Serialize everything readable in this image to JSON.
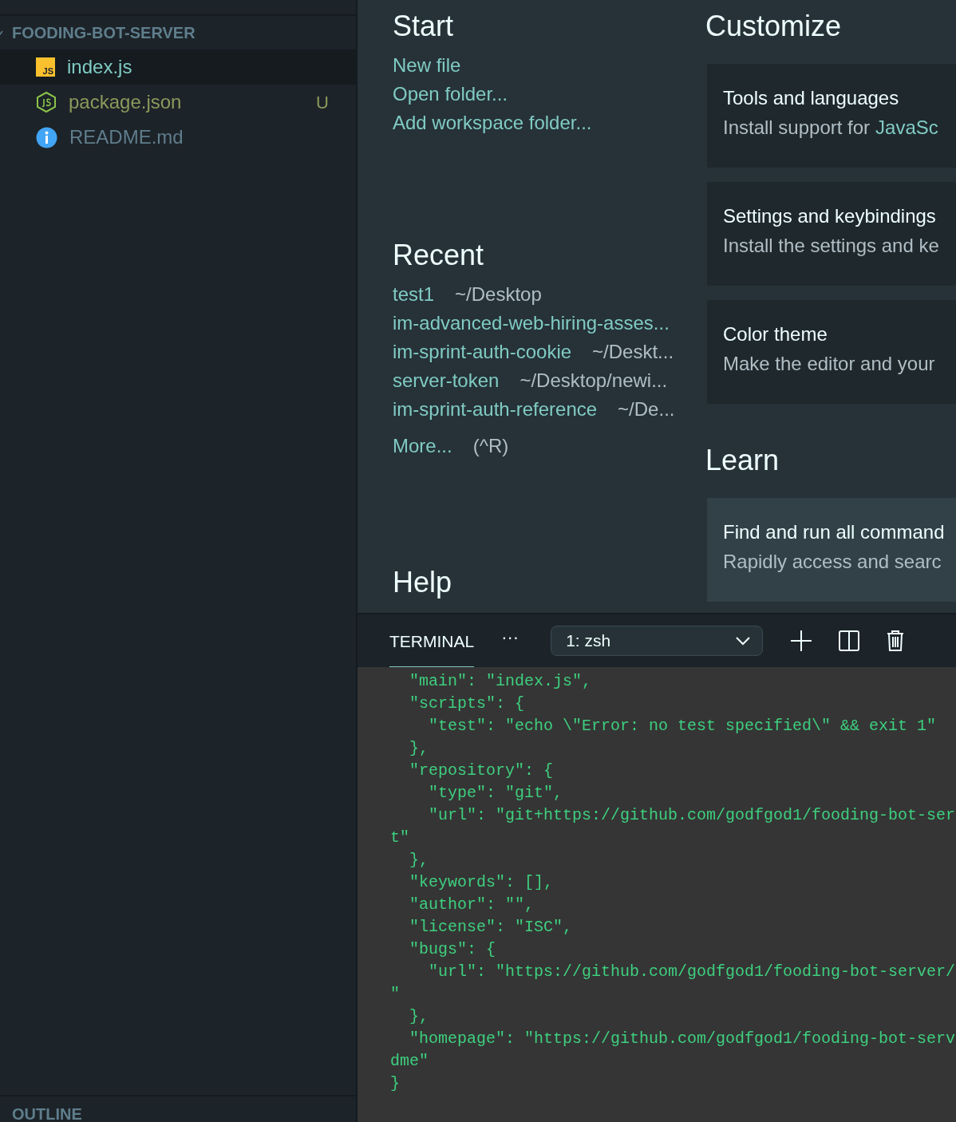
{
  "sidebar": {
    "folder": {
      "name": "FOODING-BOT-SERVER",
      "expanded": true
    },
    "files": [
      {
        "name": "index.js",
        "kind": "js",
        "icon_text": "JS",
        "selected": true
      },
      {
        "name": "package.json",
        "kind": "node",
        "selected": false,
        "git_status": "U"
      },
      {
        "name": "README.md",
        "kind": "info",
        "selected": false
      }
    ],
    "outline_title": "OUTLINE"
  },
  "welcome": {
    "start": {
      "title": "Start",
      "links": [
        "New file",
        "Open folder...",
        "Add workspace folder..."
      ]
    },
    "recent": {
      "title": "Recent",
      "items": [
        {
          "name": "test1",
          "path": "~/Desktop"
        },
        {
          "name": "im-advanced-web-hiring-asses..."
        },
        {
          "name": "im-sprint-auth-cookie",
          "path": "~/Deskt..."
        },
        {
          "name": "server-token",
          "path": "~/Desktop/newi..."
        },
        {
          "name": "im-sprint-auth-reference",
          "path": "~/De..."
        }
      ],
      "more": "More...",
      "shortcut": "(^R)"
    },
    "help": {
      "title": "Help"
    },
    "customize": {
      "title": "Customize",
      "cards": [
        {
          "title": "Tools and languages",
          "description": "Install support for",
          "link": "JavaSc"
        },
        {
          "title": "Settings and keybindings",
          "description": "Install the settings and ke"
        },
        {
          "title": "Color theme",
          "description": "Make the editor and your"
        }
      ]
    },
    "learn": {
      "title": "Learn",
      "cards": [
        {
          "title": "Find and run all command",
          "description": "Rapidly access and searc",
          "highlighted": true
        }
      ]
    }
  },
  "panel": {
    "tabs": [
      {
        "label": "TERMINAL",
        "selected": true
      }
    ],
    "more": "···",
    "terminal_select": "1: zsh",
    "terminal_lines": [
      "  \"main\": \"index.js\",",
      "  \"scripts\": {",
      "    \"test\": \"echo \\\"Error: no test specified\\\" && exit 1\"",
      "  },",
      "  \"repository\": {",
      "    \"type\": \"git\",",
      "    \"url\": \"git+https://github.com/godfgod1/fooding-bot-ser",
      "t\"",
      "  },",
      "  \"keywords\": [],",
      "  \"author\": \"\",",
      "  \"license\": \"ISC\",",
      "  \"bugs\": {",
      "    \"url\": \"https://github.com/godfgod1/fooding-bot-server/",
      "\"",
      "  },",
      "  \"homepage\": \"https://github.com/godfgod1/fooding-bot-serv",
      "dme\"",
      "}"
    ]
  }
}
